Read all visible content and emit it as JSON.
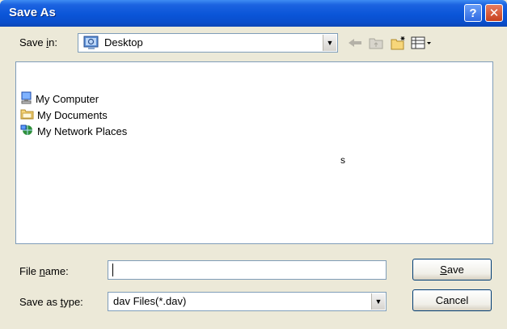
{
  "window": {
    "title": "Save As"
  },
  "save_in": {
    "label": "Save in:",
    "value": "Desktop"
  },
  "file_list": {
    "items": [
      {
        "label": "My Computer",
        "icon": "computer-icon"
      },
      {
        "label": "My Documents",
        "icon": "folder-icon"
      },
      {
        "label": "My Network Places",
        "icon": "network-icon"
      }
    ],
    "stray_text": "s"
  },
  "file_name": {
    "label": "File name:",
    "value": ""
  },
  "save_as_type": {
    "label": "Save as type:",
    "value": "dav Files(*.dav)"
  },
  "buttons": {
    "save": "Save",
    "cancel": "Cancel"
  },
  "toolbar": {
    "icons": [
      "back-icon",
      "up-folder-icon",
      "new-folder-icon",
      "view-menu-icon"
    ]
  },
  "colors": {
    "titlebar": "#0a55d8",
    "face": "#ece9d8"
  }
}
